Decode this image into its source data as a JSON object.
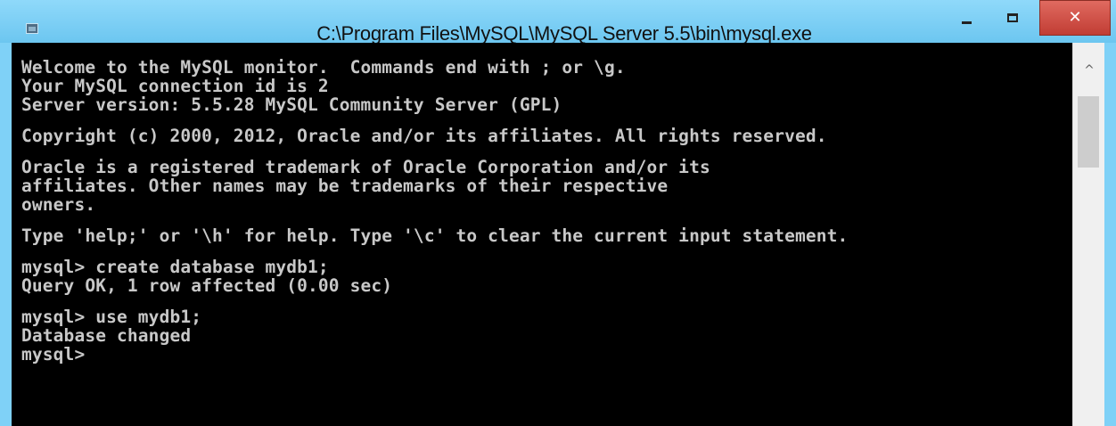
{
  "window": {
    "title": "C:\\Program Files\\MySQL\\MySQL Server 5.5\\bin\\mysql.exe",
    "icon": "console-app-icon",
    "controls": {
      "minimize_icon": "minimize-icon",
      "maximize_icon": "maximize-icon",
      "close_glyph": "✕"
    },
    "frame_color": "#7fd1f7",
    "close_color": "#c9403a"
  },
  "console": {
    "background": "#000000",
    "text_color": "#c8c8c8",
    "blocks": [
      {
        "lines": [
          "Welcome to the MySQL monitor.  Commands end with ; or \\g.",
          "Your MySQL connection id is 2",
          "Server version: 5.5.28 MySQL Community Server (GPL)"
        ]
      },
      {
        "lines": [
          "Copyright (c) 2000, 2012, Oracle and/or its affiliates. All rights reserved."
        ]
      },
      {
        "lines": [
          "Oracle is a registered trademark of Oracle Corporation and/or its",
          "affiliates. Other names may be trademarks of their respective",
          "owners."
        ]
      },
      {
        "lines": [
          "Type 'help;' or '\\h' for help. Type '\\c' to clear the current input statement."
        ]
      },
      {
        "lines": [
          "mysql> create database mydb1;",
          "Query OK, 1 row affected (0.00 sec)"
        ]
      },
      {
        "lines": [
          "mysql> use mydb1;",
          "Database changed",
          "mysql>"
        ]
      }
    ]
  },
  "scrollbar": {
    "up_arrow": "^"
  }
}
